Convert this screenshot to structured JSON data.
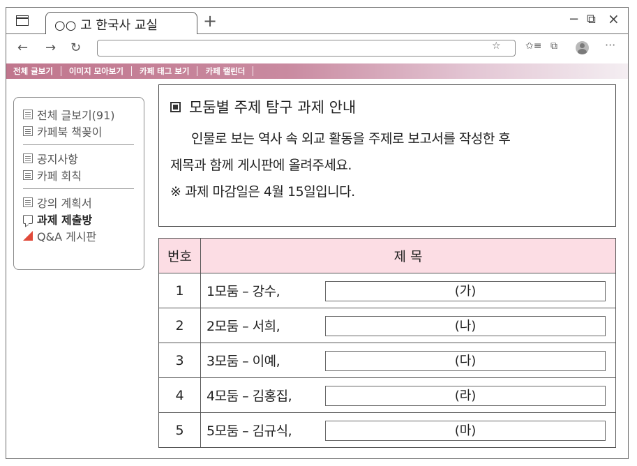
{
  "browser": {
    "tab_title": "○○ 고 한국사 교실",
    "new_tab": "+",
    "window_controls": {
      "minimize": "−",
      "restore": "⧉",
      "close": "×"
    },
    "nav": {
      "back": "←",
      "forward": "→",
      "refresh": "↻"
    },
    "address_value": "",
    "toolbar_icons": {
      "favorite": "☆",
      "favorites_list": "✩≡",
      "collections": "⧉",
      "more": "···"
    }
  },
  "cafe_menu": [
    {
      "label": "전체 글보기"
    },
    {
      "label": "이미지 모아보기"
    },
    {
      "label": "카페 태그 보기"
    },
    {
      "label": "카페 캘린더"
    }
  ],
  "sidebar": {
    "group1": [
      {
        "label": "전체 글보기(91)",
        "icon": "document-icon"
      },
      {
        "label": "카페북 책꽂이",
        "icon": "document-icon"
      }
    ],
    "group2": [
      {
        "label": "공지사항",
        "icon": "document-icon"
      },
      {
        "label": "카페 회칙",
        "icon": "document-icon"
      }
    ],
    "group3": [
      {
        "label": "강의 계획서",
        "icon": "document-icon"
      },
      {
        "label": "과제 제출방",
        "icon": "chat-icon",
        "active": true
      },
      {
        "label": "Q&A 게시판",
        "icon": "qa-board-icon"
      }
    ]
  },
  "notice": {
    "title": "모둠별 주제 탐구 과제 안내",
    "line1": "인물로 보는 역사 속 외교 활동을 주제로 보고서를 작성한 후",
    "line2": "제목과 함께 게시판에 올려주세요.",
    "line3": "※ 과제 마감일은 4월 15일입니다."
  },
  "table": {
    "headers": {
      "num": "번호",
      "title": "제 목"
    },
    "rows": [
      {
        "num": "1",
        "group": "1모둠 – 강수,",
        "answer": "(가)"
      },
      {
        "num": "2",
        "group": "2모둠 – 서희,",
        "answer": "(나)"
      },
      {
        "num": "3",
        "group": "3모둠 – 이예,",
        "answer": "(다)"
      },
      {
        "num": "4",
        "group": "4모둠 – 김홍집,",
        "answer": "(라)"
      },
      {
        "num": "5",
        "group": "5모둠 – 김규식,",
        "answer": "(마)"
      }
    ]
  },
  "colors": {
    "menu_bar_start": "#c0768d",
    "menu_bar_end": "#f4eef2",
    "table_header_bg": "#fcdde4",
    "qa_icon": "#e04a3a"
  }
}
